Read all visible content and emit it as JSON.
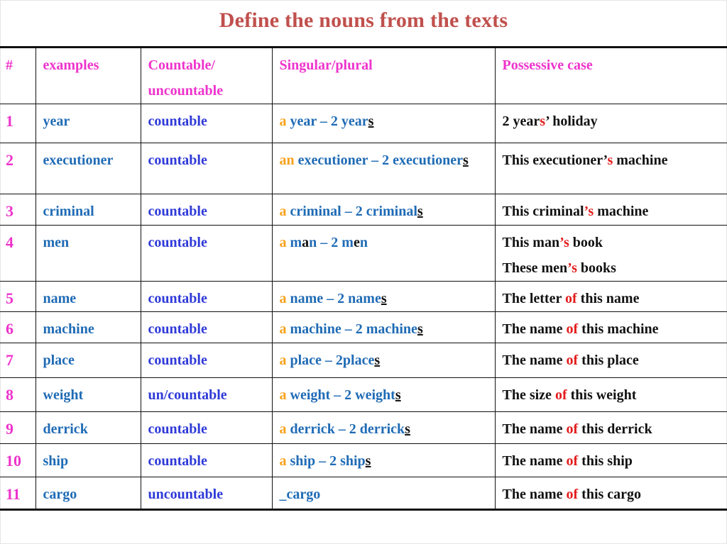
{
  "title": "Define the nouns  from the texts",
  "colors": {
    "title": "#c0504d",
    "header": "#ee33cc",
    "row_number": "#ee33cc",
    "example": "#1f6bb5",
    "countability": "#2f3ad8",
    "article": "#f7a21b",
    "possessive_marker": "#e41b1b",
    "text": "#111111"
  },
  "table": {
    "headers": [
      "#",
      "examples",
      "Countable/ uncountable",
      "Singular/plural",
      "Possessive case"
    ],
    "rows": [
      {
        "num": "1",
        "example": "year",
        "countability": "countable",
        "singular_plural": [
          {
            "t": "a",
            "c": "art"
          },
          {
            "t": " year – 2 year",
            "c": "sg"
          },
          {
            "t": "s",
            "c": "ul"
          }
        ],
        "possessive": [
          [
            {
              "t": "2 year",
              "c": "pos"
            },
            {
              "t": "s",
              "c": "red"
            },
            {
              "t": "’ holiday",
              "c": "pos"
            }
          ]
        ]
      },
      {
        "num": "2",
        "example": "executioner",
        "countability": "countable",
        "singular_plural": [
          {
            "t": "an",
            "c": "art"
          },
          {
            "t": " executioner – 2 executioner",
            "c": "sg"
          },
          {
            "t": "s",
            "c": "ul"
          }
        ],
        "possessive": [
          [
            {
              "t": "This executioner’",
              "c": "pos"
            },
            {
              "t": "s",
              "c": "red"
            },
            {
              "t": " machine",
              "c": "pos"
            }
          ]
        ]
      },
      {
        "num": "3",
        "example": "criminal",
        "countability": "countable",
        "singular_plural": [
          {
            "t": "a",
            "c": "art"
          },
          {
            "t": " criminal – 2 criminal",
            "c": "sg"
          },
          {
            "t": "s",
            "c": "ul"
          }
        ],
        "possessive": [
          [
            {
              "t": "This criminal",
              "c": "pos"
            },
            {
              "t": "’s",
              "c": "red"
            },
            {
              "t": " machine",
              "c": "pos"
            }
          ]
        ]
      },
      {
        "num": "4",
        "example": "men",
        "countability": "countable",
        "singular_plural": [
          {
            "t": "a",
            "c": "art"
          },
          {
            "t": " m",
            "c": "sg"
          },
          {
            "t": "a",
            "c": "blk"
          },
          {
            "t": "n – 2 m",
            "c": "sg"
          },
          {
            "t": "e",
            "c": "blk"
          },
          {
            "t": "n",
            "c": "sg"
          }
        ],
        "possessive": [
          [
            {
              "t": "This man",
              "c": "pos"
            },
            {
              "t": "’s",
              "c": "red"
            },
            {
              "t": " book",
              "c": "pos"
            }
          ],
          [
            {
              "t": "These men",
              "c": "pos"
            },
            {
              "t": "’s",
              "c": "red"
            },
            {
              "t": " books",
              "c": "pos"
            }
          ]
        ]
      },
      {
        "num": "5",
        "example": "name",
        "countability": "countable",
        "singular_plural": [
          {
            "t": "a",
            "c": "art"
          },
          {
            "t": " name – 2 name",
            "c": "sg"
          },
          {
            "t": "s",
            "c": "ul"
          }
        ],
        "possessive": [
          [
            {
              "t": "The letter ",
              "c": "pos"
            },
            {
              "t": "of",
              "c": "red"
            },
            {
              "t": " this name",
              "c": "pos"
            }
          ]
        ]
      },
      {
        "num": "6",
        "example": "machine",
        "countability": "countable",
        "singular_plural": [
          {
            "t": "a",
            "c": "art"
          },
          {
            "t": " machine – 2 machine",
            "c": "sg"
          },
          {
            "t": "s",
            "c": "ul"
          }
        ],
        "possessive": [
          [
            {
              "t": "The name ",
              "c": "pos"
            },
            {
              "t": "of",
              "c": "red"
            },
            {
              "t": " this machine",
              "c": "pos"
            }
          ]
        ]
      },
      {
        "num": "7",
        "example": "place",
        "countability": "countable",
        "singular_plural": [
          {
            "t": "a",
            "c": "art"
          },
          {
            "t": " place – 2place",
            "c": "sg"
          },
          {
            "t": "s",
            "c": "ul"
          }
        ],
        "possessive": [
          [
            {
              "t": "The name ",
              "c": "pos"
            },
            {
              "t": "of",
              "c": "red"
            },
            {
              "t": " this place",
              "c": "pos"
            }
          ]
        ]
      },
      {
        "num": "8",
        "example": "weight",
        "countability": "un/countable",
        "singular_plural": [
          {
            "t": "a",
            "c": "art"
          },
          {
            "t": " weight – 2 weight",
            "c": "sg"
          },
          {
            "t": "s",
            "c": "ul"
          }
        ],
        "possessive": [
          [
            {
              "t": "The size ",
              "c": "pos"
            },
            {
              "t": "of",
              "c": "red"
            },
            {
              "t": " this weight",
              "c": "pos"
            }
          ]
        ]
      },
      {
        "num": "9",
        "example": "derrick",
        "countability": "countable",
        "singular_plural": [
          {
            "t": "a",
            "c": "art"
          },
          {
            "t": " derrick – 2 derrick",
            "c": "sg"
          },
          {
            "t": "s",
            "c": "ul"
          }
        ],
        "possessive": [
          [
            {
              "t": "The name ",
              "c": "pos"
            },
            {
              "t": "of",
              "c": "red"
            },
            {
              "t": " this derrick",
              "c": "pos"
            }
          ]
        ]
      },
      {
        "num": "10",
        "example": "ship",
        "countability": "countable",
        "singular_plural": [
          {
            "t": "a",
            "c": "art"
          },
          {
            "t": " ship – 2 ship",
            "c": "sg"
          },
          {
            "t": "s",
            "c": "ul"
          }
        ],
        "possessive": [
          [
            {
              "t": "The name ",
              "c": "pos"
            },
            {
              "t": "of",
              "c": "red"
            },
            {
              "t": " this ship",
              "c": "pos"
            }
          ]
        ]
      },
      {
        "num": "11",
        "example": "cargo",
        "countability": "uncountable",
        "singular_plural": [
          {
            "t": "_cargo",
            "c": "sg"
          }
        ],
        "possessive": [
          [
            {
              "t": "The name ",
              "c": "pos"
            },
            {
              "t": "of",
              "c": "red"
            },
            {
              "t": " this cargo",
              "c": "pos"
            }
          ]
        ]
      }
    ]
  }
}
